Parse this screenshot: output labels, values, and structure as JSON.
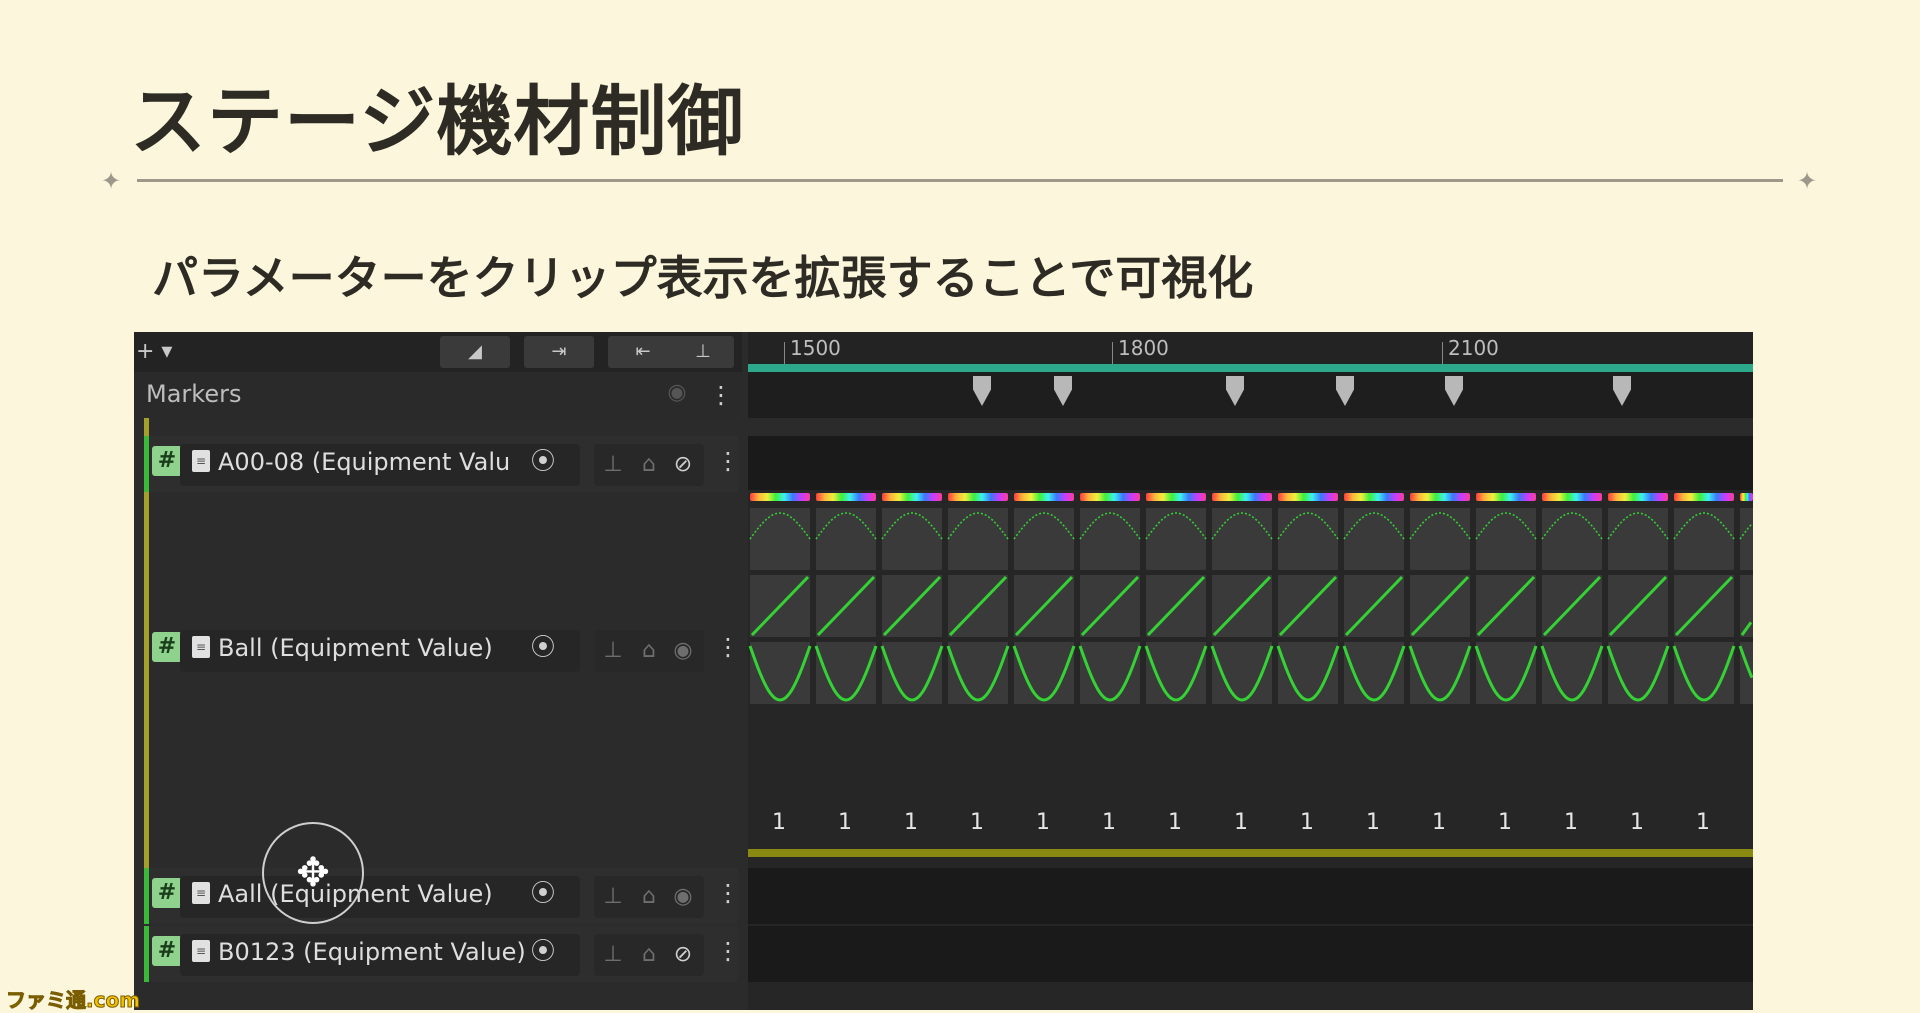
{
  "slide": {
    "title": "ステージ機材制御",
    "subtitle": "パラメーターをクリップ表示を拡張することで可視化"
  },
  "watermark": "ファミ通.com",
  "timeline": {
    "toolbar": {
      "add_label": "+ ▾",
      "btn1_icon": "◢",
      "btn2_icon": "⇥",
      "btn3_icon": "⇤",
      "pin_icon": "⊥"
    },
    "ruler_labels": [
      "1500",
      "1800",
      "2100"
    ],
    "markers_label": "Markers",
    "tracks": [
      {
        "name": "A00-08 (Equipment Valu",
        "visibility": "hidden"
      },
      {
        "name": "Ball (Equipment Value)",
        "visibility": "visible"
      },
      {
        "name": "Aall (Equipment Value)",
        "visibility": "visible"
      },
      {
        "name": "B0123 (Equipment Value)",
        "visibility": "hidden"
      }
    ],
    "hash_glyph": "#",
    "doc_glyph": "≡",
    "target_glyph": "⦿",
    "kebab_glyph": "⋮",
    "value_label": "1",
    "colors": {
      "track_green": "#8fd28d",
      "curve_green": "#34d234",
      "teal": "#2ba98a",
      "olive": "#8a8a12"
    }
  }
}
